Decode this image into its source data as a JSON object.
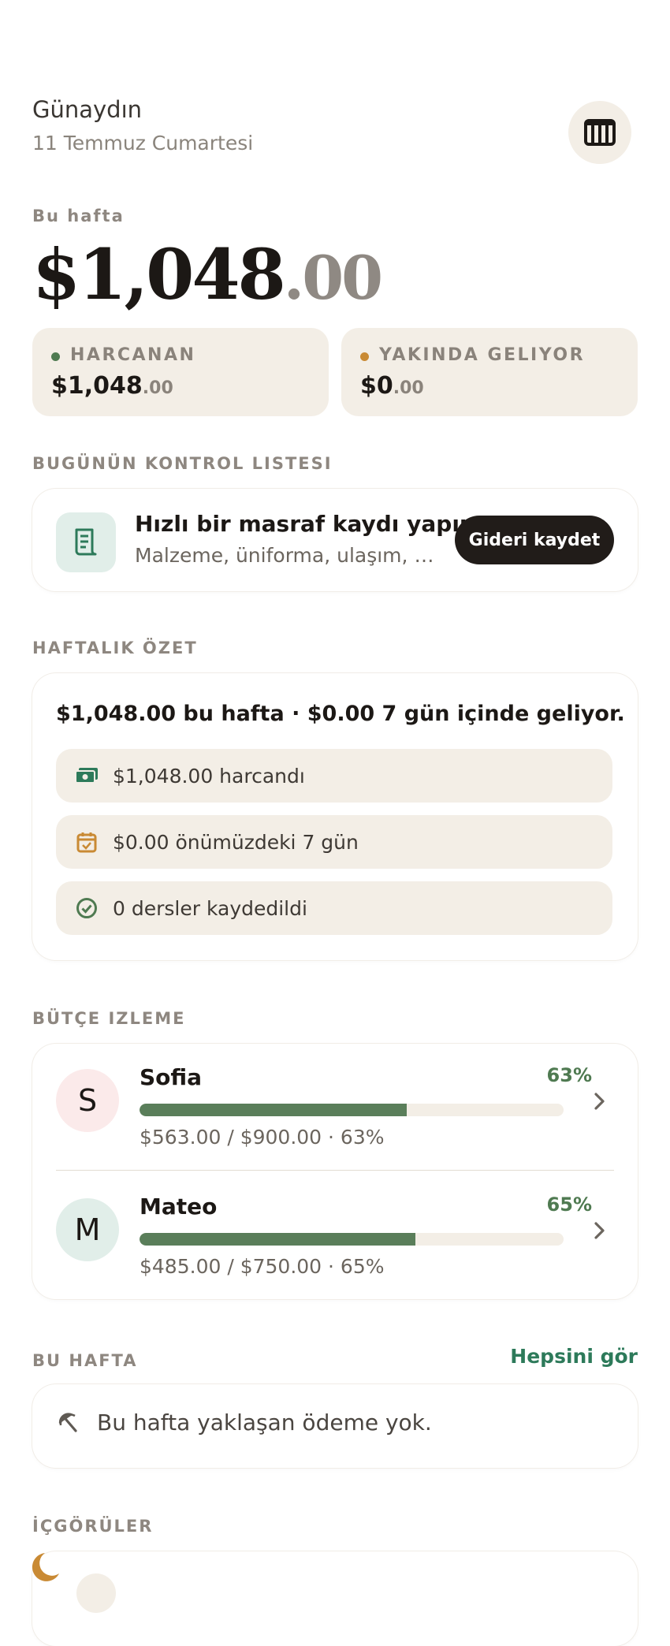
{
  "header": {
    "greeting": "Günaydın",
    "date": "11 Temmuz Cumartesi",
    "calendar_icon": "calendar-grid-icon"
  },
  "week": {
    "label": "Bu hafta",
    "amount_whole": "$1,048",
    "amount_cents": ".00"
  },
  "pills": [
    {
      "label": "HARCANAN",
      "value_whole": "$1,048",
      "value_cents": ".00",
      "dot_color": "#4f7a51"
    },
    {
      "label": "YAKINDA GELIYOR",
      "value_whole": "$0",
      "value_cents": ".00",
      "dot_color": "#c98a34"
    }
  ],
  "checklist": {
    "section_label": "BUGÜNÜN KONTROL LISTESI",
    "title": "Hızlı bir masraf kaydı yapın",
    "subtitle": "Malzeme, üniforma, ulaşım, yiyecek…",
    "button_label": "Gideri kaydet",
    "icon": "receipt-icon"
  },
  "summary": {
    "section_label": "HAFTALIK ÖZET",
    "headline": "$1,048.00 bu hafta · $0.00 7 gün içinde geliyor.",
    "rows": [
      {
        "icon": "cash-icon",
        "text": "$1,048.00 harcandı"
      },
      {
        "icon": "calendar-check-icon",
        "text": "$0.00 önümüzdeki 7 gün"
      },
      {
        "icon": "check-circle-icon",
        "text": "0 dersler kaydedildi"
      }
    ]
  },
  "budget": {
    "section_label": "BÜTÇE IZLEME",
    "items": [
      {
        "initial": "S",
        "name": "Sofia",
        "percent_label": "63%",
        "progress": 0.63,
        "detail": "$563.00 / $900.00 · 63%",
        "avatar_color": "#fbeaea"
      },
      {
        "initial": "M",
        "name": "Mateo",
        "percent_label": "65%",
        "progress": 0.65,
        "detail": "$485.00 / $750.00 · 65%",
        "avatar_color": "#e1eee9"
      }
    ]
  },
  "this_week": {
    "section_label": "BU HAFTA",
    "see_all": "Hepsini gör",
    "empty_text": "Bu hafta yaklaşan ödeme yok."
  },
  "insights": {
    "section_label": "İÇGÖRÜLER"
  },
  "colors": {
    "accent_green": "#2d7a5a",
    "bar_green": "#5a7e5a",
    "surface": "#f3eee6",
    "dark": "#211c19"
  }
}
